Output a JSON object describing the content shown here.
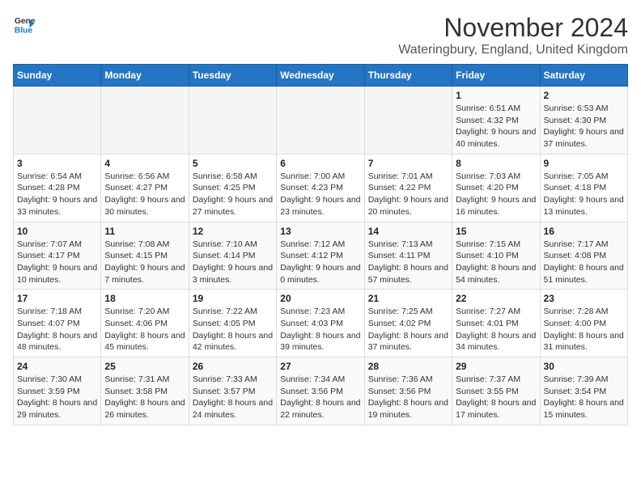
{
  "header": {
    "logo_line1": "General",
    "logo_line2": "Blue",
    "month_title": "November 2024",
    "location": "Wateringbury, England, United Kingdom"
  },
  "weekdays": [
    "Sunday",
    "Monday",
    "Tuesday",
    "Wednesday",
    "Thursday",
    "Friday",
    "Saturday"
  ],
  "weeks": [
    [
      {
        "day": "",
        "info": ""
      },
      {
        "day": "",
        "info": ""
      },
      {
        "day": "",
        "info": ""
      },
      {
        "day": "",
        "info": ""
      },
      {
        "day": "",
        "info": ""
      },
      {
        "day": "1",
        "info": "Sunrise: 6:51 AM\nSunset: 4:32 PM\nDaylight: 9 hours and 40 minutes."
      },
      {
        "day": "2",
        "info": "Sunrise: 6:53 AM\nSunset: 4:30 PM\nDaylight: 9 hours and 37 minutes."
      }
    ],
    [
      {
        "day": "3",
        "info": "Sunrise: 6:54 AM\nSunset: 4:28 PM\nDaylight: 9 hours and 33 minutes."
      },
      {
        "day": "4",
        "info": "Sunrise: 6:56 AM\nSunset: 4:27 PM\nDaylight: 9 hours and 30 minutes."
      },
      {
        "day": "5",
        "info": "Sunrise: 6:58 AM\nSunset: 4:25 PM\nDaylight: 9 hours and 27 minutes."
      },
      {
        "day": "6",
        "info": "Sunrise: 7:00 AM\nSunset: 4:23 PM\nDaylight: 9 hours and 23 minutes."
      },
      {
        "day": "7",
        "info": "Sunrise: 7:01 AM\nSunset: 4:22 PM\nDaylight: 9 hours and 20 minutes."
      },
      {
        "day": "8",
        "info": "Sunrise: 7:03 AM\nSunset: 4:20 PM\nDaylight: 9 hours and 16 minutes."
      },
      {
        "day": "9",
        "info": "Sunrise: 7:05 AM\nSunset: 4:18 PM\nDaylight: 9 hours and 13 minutes."
      }
    ],
    [
      {
        "day": "10",
        "info": "Sunrise: 7:07 AM\nSunset: 4:17 PM\nDaylight: 9 hours and 10 minutes."
      },
      {
        "day": "11",
        "info": "Sunrise: 7:08 AM\nSunset: 4:15 PM\nDaylight: 9 hours and 7 minutes."
      },
      {
        "day": "12",
        "info": "Sunrise: 7:10 AM\nSunset: 4:14 PM\nDaylight: 9 hours and 3 minutes."
      },
      {
        "day": "13",
        "info": "Sunrise: 7:12 AM\nSunset: 4:12 PM\nDaylight: 9 hours and 0 minutes."
      },
      {
        "day": "14",
        "info": "Sunrise: 7:13 AM\nSunset: 4:11 PM\nDaylight: 8 hours and 57 minutes."
      },
      {
        "day": "15",
        "info": "Sunrise: 7:15 AM\nSunset: 4:10 PM\nDaylight: 8 hours and 54 minutes."
      },
      {
        "day": "16",
        "info": "Sunrise: 7:17 AM\nSunset: 4:08 PM\nDaylight: 8 hours and 51 minutes."
      }
    ],
    [
      {
        "day": "17",
        "info": "Sunrise: 7:18 AM\nSunset: 4:07 PM\nDaylight: 8 hours and 48 minutes."
      },
      {
        "day": "18",
        "info": "Sunrise: 7:20 AM\nSunset: 4:06 PM\nDaylight: 8 hours and 45 minutes."
      },
      {
        "day": "19",
        "info": "Sunrise: 7:22 AM\nSunset: 4:05 PM\nDaylight: 8 hours and 42 minutes."
      },
      {
        "day": "20",
        "info": "Sunrise: 7:23 AM\nSunset: 4:03 PM\nDaylight: 8 hours and 39 minutes."
      },
      {
        "day": "21",
        "info": "Sunrise: 7:25 AM\nSunset: 4:02 PM\nDaylight: 8 hours and 37 minutes."
      },
      {
        "day": "22",
        "info": "Sunrise: 7:27 AM\nSunset: 4:01 PM\nDaylight: 8 hours and 34 minutes."
      },
      {
        "day": "23",
        "info": "Sunrise: 7:28 AM\nSunset: 4:00 PM\nDaylight: 8 hours and 31 minutes."
      }
    ],
    [
      {
        "day": "24",
        "info": "Sunrise: 7:30 AM\nSunset: 3:59 PM\nDaylight: 8 hours and 29 minutes."
      },
      {
        "day": "25",
        "info": "Sunrise: 7:31 AM\nSunset: 3:58 PM\nDaylight: 8 hours and 26 minutes."
      },
      {
        "day": "26",
        "info": "Sunrise: 7:33 AM\nSunset: 3:57 PM\nDaylight: 8 hours and 24 minutes."
      },
      {
        "day": "27",
        "info": "Sunrise: 7:34 AM\nSunset: 3:56 PM\nDaylight: 8 hours and 22 minutes."
      },
      {
        "day": "28",
        "info": "Sunrise: 7:36 AM\nSunset: 3:56 PM\nDaylight: 8 hours and 19 minutes."
      },
      {
        "day": "29",
        "info": "Sunrise: 7:37 AM\nSunset: 3:55 PM\nDaylight: 8 hours and 17 minutes."
      },
      {
        "day": "30",
        "info": "Sunrise: 7:39 AM\nSunset: 3:54 PM\nDaylight: 8 hours and 15 minutes."
      }
    ]
  ]
}
